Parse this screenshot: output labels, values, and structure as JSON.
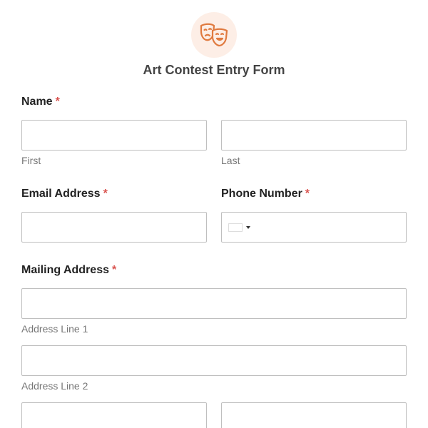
{
  "header": {
    "logo_icon": "theater-masks-icon",
    "accent_color": "#e07a3f",
    "title": "Art Contest Entry Form"
  },
  "fields": {
    "name": {
      "label": "Name",
      "required_mark": "*",
      "first_sublabel": "First",
      "last_sublabel": "Last"
    },
    "email": {
      "label": "Email Address",
      "required_mark": "*"
    },
    "phone": {
      "label": "Phone Number",
      "required_mark": "*",
      "country_flag_icon": "flag-icon",
      "dropdown_icon": "caret-down-icon"
    },
    "mailing_address": {
      "label": "Mailing Address",
      "required_mark": "*",
      "line1_sublabel": "Address Line 1",
      "line2_sublabel": "Address Line 2"
    }
  },
  "colors": {
    "required": "#d9534f",
    "input_border": "#bfbfbf",
    "sublabel": "#777777"
  }
}
